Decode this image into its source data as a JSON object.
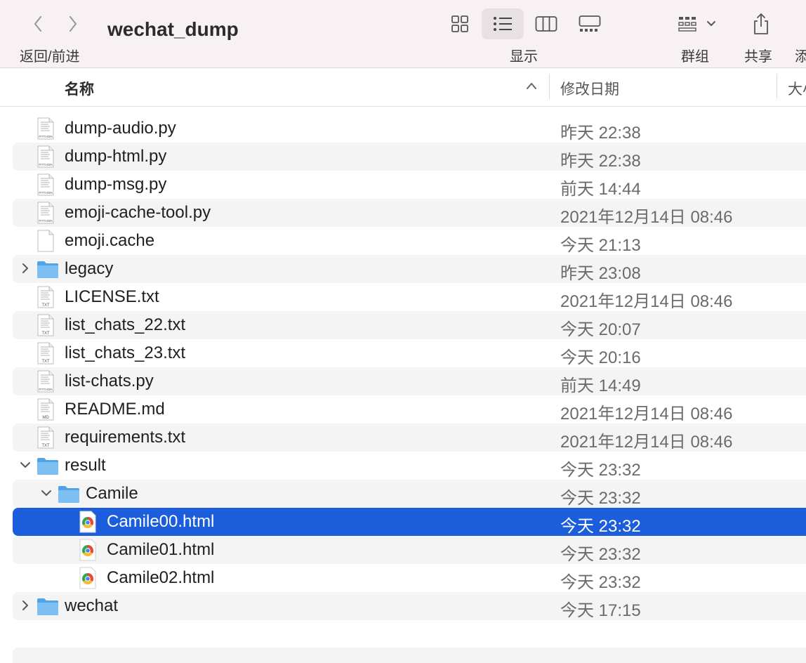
{
  "window": {
    "title": "wechat_dump"
  },
  "toolbar": {
    "nav_label": "返回/前进",
    "view_label": "显示",
    "group_label": "群组",
    "share_label": "共享",
    "add_label_partial": "添"
  },
  "columns": {
    "name": "名称",
    "date": "修改日期",
    "size_partial": "大小"
  },
  "files": [
    {
      "name": "dump-audio.py",
      "date": "昨天 22:38",
      "kind": "python",
      "level": 0,
      "disclosure": "none",
      "selected": false
    },
    {
      "name": "dump-html.py",
      "date": "昨天 22:38",
      "kind": "python",
      "level": 0,
      "disclosure": "none",
      "selected": false
    },
    {
      "name": "dump-msg.py",
      "date": "前天 14:44",
      "kind": "python",
      "level": 0,
      "disclosure": "none",
      "selected": false
    },
    {
      "name": "emoji-cache-tool.py",
      "date": "2021年12月14日 08:46",
      "kind": "python",
      "level": 0,
      "disclosure": "none",
      "selected": false
    },
    {
      "name": "emoji.cache",
      "date": "今天 21:13",
      "kind": "blank",
      "level": 0,
      "disclosure": "none",
      "selected": false
    },
    {
      "name": "legacy",
      "date": "昨天 23:08",
      "kind": "folder",
      "level": 0,
      "disclosure": "collapsed",
      "selected": false
    },
    {
      "name": "LICENSE.txt",
      "date": "2021年12月14日 08:46",
      "kind": "txt",
      "level": 0,
      "disclosure": "none",
      "selected": false
    },
    {
      "name": "list_chats_22.txt",
      "date": "今天 20:07",
      "kind": "txt",
      "level": 0,
      "disclosure": "none",
      "selected": false
    },
    {
      "name": "list_chats_23.txt",
      "date": "今天 20:16",
      "kind": "txt",
      "level": 0,
      "disclosure": "none",
      "selected": false
    },
    {
      "name": "list-chats.py",
      "date": "前天 14:49",
      "kind": "python",
      "level": 0,
      "disclosure": "none",
      "selected": false
    },
    {
      "name": "README.md",
      "date": "2021年12月14日 08:46",
      "kind": "md",
      "level": 0,
      "disclosure": "none",
      "selected": false
    },
    {
      "name": "requirements.txt",
      "date": "2021年12月14日 08:46",
      "kind": "txt",
      "level": 0,
      "disclosure": "none",
      "selected": false
    },
    {
      "name": "result",
      "date": "今天 23:32",
      "kind": "folder",
      "level": 0,
      "disclosure": "expanded",
      "selected": false
    },
    {
      "name": "Camile",
      "date": "今天 23:32",
      "kind": "folder",
      "level": 1,
      "disclosure": "expanded",
      "selected": false
    },
    {
      "name": "Camile00.html",
      "date": "今天 23:32",
      "kind": "chrome",
      "level": 2,
      "disclosure": "none",
      "selected": true
    },
    {
      "name": "Camile01.html",
      "date": "今天 23:32",
      "kind": "chrome",
      "level": 2,
      "disclosure": "none",
      "selected": false
    },
    {
      "name": "Camile02.html",
      "date": "今天 23:32",
      "kind": "chrome",
      "level": 2,
      "disclosure": "none",
      "selected": false
    },
    {
      "name": "wechat",
      "date": "今天 17:15",
      "kind": "folder",
      "level": 0,
      "disclosure": "collapsed",
      "selected": false
    }
  ],
  "doc_badges": {
    "python": "PYTHON",
    "txt": "TXT",
    "md": "MD"
  },
  "colors": {
    "toolbar_bg": "#f8f1f3",
    "selection": "#1b5ddb",
    "stripe": "#f4f4f4",
    "folder": "#6fb8ee"
  }
}
